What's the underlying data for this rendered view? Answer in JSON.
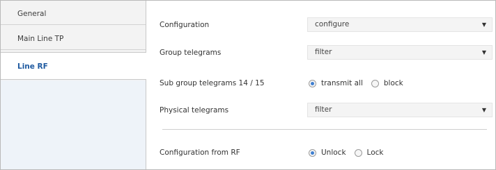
{
  "sidebar": {
    "tabs": [
      {
        "label": "General",
        "selected": false
      },
      {
        "label": "Main Line TP",
        "selected": false
      },
      {
        "label": "Line RF",
        "selected": true
      }
    ]
  },
  "params": {
    "configuration": {
      "label": "Configuration",
      "value": "configure"
    },
    "group_telegrams": {
      "label": "Group telegrams",
      "value": "filter"
    },
    "sub_group_telegrams": {
      "label": "Sub group telegrams 14 / 15",
      "options": [
        {
          "label": "transmit all",
          "selected": true
        },
        {
          "label": "block",
          "selected": false
        }
      ]
    },
    "physical_telegrams": {
      "label": "Physical telegrams",
      "value": "filter"
    },
    "configuration_from_rf": {
      "label": "Configuration from RF",
      "options": [
        {
          "label": "Unlock",
          "selected": true
        },
        {
          "label": "Lock",
          "selected": false
        }
      ]
    }
  },
  "icons": {
    "dropdown": "chevron-down-icon",
    "radio": "radio-icon"
  },
  "colors": {
    "active_tab_text": "#1f5aa0",
    "radio_selected": "#3f7fd0"
  }
}
